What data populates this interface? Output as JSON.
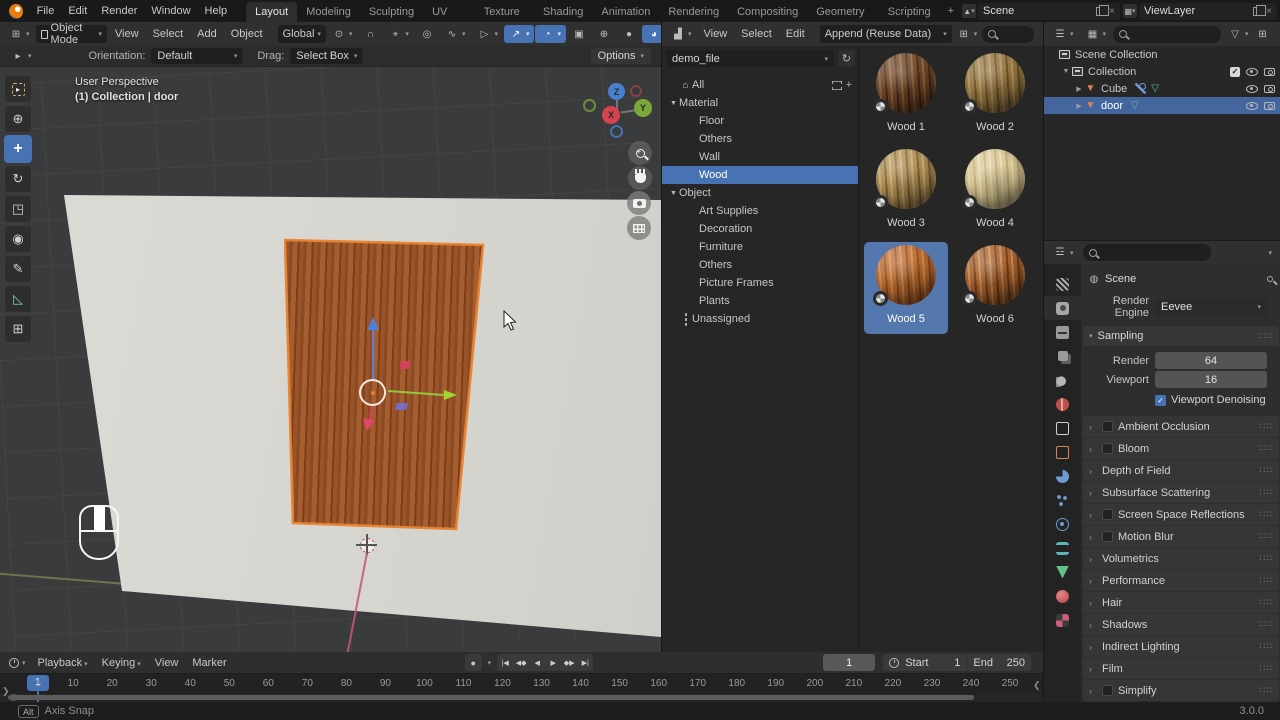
{
  "icons": {
    "chevron": "▾",
    "expander_down": "▼",
    "expander_right": "▶",
    "home": "⌂",
    "refresh": "↻",
    "plus": "+",
    "close": "×",
    "check": "✓",
    "magnet": "∩",
    "pivot": "⊙",
    "proportional": "◎",
    "falloff": "∿",
    "snap_target": "⌖",
    "visibility": "▷",
    "gizmo": "↗",
    "overlays": "◔",
    "xray": "▣",
    "shade_wireframe": "⊕",
    "shade_solid": "●",
    "shade_material": "◕",
    "editor_grid": "⊞",
    "mode_square": "▢",
    "record": "●",
    "arrow_small": "›",
    "grip": "∷∷"
  },
  "topbar": {
    "menus": [
      "File",
      "Edit",
      "Render",
      "Window",
      "Help"
    ],
    "tabs": [
      {
        "label": "Layout",
        "active": true
      },
      {
        "label": "Modeling"
      },
      {
        "label": "Sculpting"
      },
      {
        "label": "UV Editing"
      },
      {
        "label": "Texture Paint"
      },
      {
        "label": "Shading"
      },
      {
        "label": "Animation"
      },
      {
        "label": "Rendering"
      },
      {
        "label": "Compositing"
      },
      {
        "label": "Geometry Nodes"
      },
      {
        "label": "Scripting"
      }
    ],
    "add_workspace": "+",
    "scene": {
      "label": "Scene"
    },
    "view_layer": {
      "label": "ViewLayer"
    }
  },
  "viewport": {
    "header": {
      "mode": "Object Mode",
      "menus": [
        "View",
        "Select",
        "Add",
        "Object"
      ],
      "orientation": "Global"
    },
    "tool_settings": {
      "orientation_label": "Orientation:",
      "orientation_value": "Default",
      "drag_label": "Drag:",
      "drag_value": "Select Box",
      "options_label": "Options"
    },
    "overlay": {
      "line1": "User Perspective",
      "line2": "(1) Collection | door"
    },
    "axes": {
      "x": "X",
      "y": "Y",
      "z": "Z"
    }
  },
  "toolbar": {
    "tools": [
      {
        "name": "select-box"
      },
      {
        "name": "cursor"
      },
      {
        "name": "move",
        "active": true
      },
      {
        "name": "rotate"
      },
      {
        "name": "scale"
      },
      {
        "name": "transform"
      },
      {
        "name": "annotate"
      },
      {
        "name": "measure"
      },
      {
        "name": "add-cube"
      }
    ]
  },
  "asset_browser": {
    "menus": [
      "View",
      "Select",
      "Edit"
    ],
    "append_label": "Append (Reuse Data)",
    "source": "demo_file",
    "catalogs": [
      {
        "label": "All",
        "icon": "home",
        "has_right_icons": true
      },
      {
        "label": "Material",
        "expander": "down"
      },
      {
        "label": "Floor",
        "indent": 1
      },
      {
        "label": "Others",
        "indent": 1
      },
      {
        "label": "Wall",
        "indent": 1
      },
      {
        "label": "Wood",
        "indent": 1,
        "selected": true
      },
      {
        "label": "Object",
        "expander": "down"
      },
      {
        "label": "Art Supplies",
        "indent": 1
      },
      {
        "label": "Decoration",
        "indent": 1
      },
      {
        "label": "Furniture",
        "indent": 1
      },
      {
        "label": "Others",
        "indent": 1
      },
      {
        "label": "Picture Frames",
        "indent": 1
      },
      {
        "label": "Plants",
        "indent": 1
      },
      {
        "label": "Unassigned",
        "icon": "unassigned"
      }
    ],
    "assets": [
      {
        "name": "Wood 1",
        "base": "#6e4526",
        "dark": "#432815",
        "light": "#96653a"
      },
      {
        "name": "Wood 2",
        "base": "#97763f",
        "dark": "#635028",
        "light": "#b3945a"
      },
      {
        "name": "Wood 3",
        "base": "#b08f52",
        "dark": "#7d6134",
        "light": "#cfae74"
      },
      {
        "name": "Wood 4",
        "base": "#d9c894",
        "dark": "#bfa972",
        "light": "#e9dcae"
      },
      {
        "name": "Wood 5",
        "base": "#bc6a2f",
        "dark": "#8f4b1c",
        "light": "#d98b47",
        "selected": true
      },
      {
        "name": "Wood 6",
        "base": "#a8602a",
        "dark": "#6f3b16",
        "light": "#c98a52"
      }
    ]
  },
  "outliner": {
    "rows": [
      {
        "label": "Scene Collection",
        "icon": "collection",
        "level": 0
      },
      {
        "label": "Collection",
        "icon": "collection",
        "level": 1,
        "expander": "down",
        "checkbox": true,
        "eye": true,
        "camera": true
      },
      {
        "label": "Cube",
        "icon": "mesh",
        "level": 2,
        "expander": "right",
        "mid": [
          "wrench",
          "mesh-data"
        ],
        "eye": true,
        "camera": true
      },
      {
        "label": "door",
        "icon": "mesh",
        "level": 2,
        "expander": "right",
        "mid": [
          "mesh-data"
        ],
        "eye": true,
        "camera": true,
        "selected": true
      }
    ]
  },
  "properties": {
    "breadcrumb": "Scene",
    "render_engine_label": "Render Engine",
    "render_engine": "Eevee",
    "sampling": {
      "title": "Sampling",
      "render_label": "Render",
      "render_value": "64",
      "viewport_label": "Viewport",
      "viewport_value": "16",
      "denoise_label": "Viewport Denoising",
      "denoise_checked": true
    },
    "tabs": [
      {
        "name": "tool"
      },
      {
        "name": "render",
        "active": true
      },
      {
        "name": "output"
      },
      {
        "name": "view-layer"
      },
      {
        "name": "scene"
      },
      {
        "name": "world"
      },
      {
        "name": "collection"
      },
      {
        "name": "object"
      },
      {
        "name": "modifiers"
      },
      {
        "name": "particles"
      },
      {
        "name": "physics"
      },
      {
        "name": "constraints"
      },
      {
        "name": "object-data"
      },
      {
        "name": "material"
      },
      {
        "name": "texture"
      }
    ],
    "panels": [
      {
        "label": "Ambient Occlusion",
        "checkbox": true
      },
      {
        "label": "Bloom",
        "checkbox": true
      },
      {
        "label": "Depth of Field"
      },
      {
        "label": "Subsurface Scattering"
      },
      {
        "label": "Screen Space Reflections",
        "checkbox": true
      },
      {
        "label": "Motion Blur",
        "checkbox": true
      },
      {
        "label": "Volumetrics"
      },
      {
        "label": "Performance"
      },
      {
        "label": "Hair"
      },
      {
        "label": "Shadows"
      },
      {
        "label": "Indirect Lighting"
      },
      {
        "label": "Film"
      },
      {
        "label": "Simplify",
        "checkbox": true
      }
    ]
  },
  "timeline": {
    "menus": [
      "Playback",
      "Keying",
      "View",
      "Marker"
    ],
    "playback_buttons": [
      {
        "name": "jump-to-start",
        "glyph": "|◀"
      },
      {
        "name": "prev-keyframe",
        "glyph": "◀◆"
      },
      {
        "name": "play-reverse",
        "glyph": "◀"
      },
      {
        "name": "play",
        "glyph": "▶"
      },
      {
        "name": "next-keyframe",
        "glyph": "◆▶"
      },
      {
        "name": "jump-to-end",
        "glyph": "▶|"
      }
    ],
    "current_frame": "1",
    "start_label": "Start",
    "start_value": "1",
    "end_label": "End",
    "end_value": "250",
    "ticks": [
      1,
      10,
      20,
      30,
      40,
      50,
      60,
      70,
      80,
      90,
      100,
      110,
      120,
      130,
      140,
      150,
      160,
      170,
      180,
      190,
      200,
      210,
      220,
      230,
      240,
      250
    ]
  },
  "statusbar": {
    "key": "Alt",
    "hint": "Axis Snap",
    "version": "3.0.0"
  },
  "colors": {
    "accent": "#4772b3",
    "selection_outline": "#e8832f",
    "axis_x": "#d6434f",
    "axis_y": "#7ba83b",
    "axis_z": "#4a7fd0"
  }
}
